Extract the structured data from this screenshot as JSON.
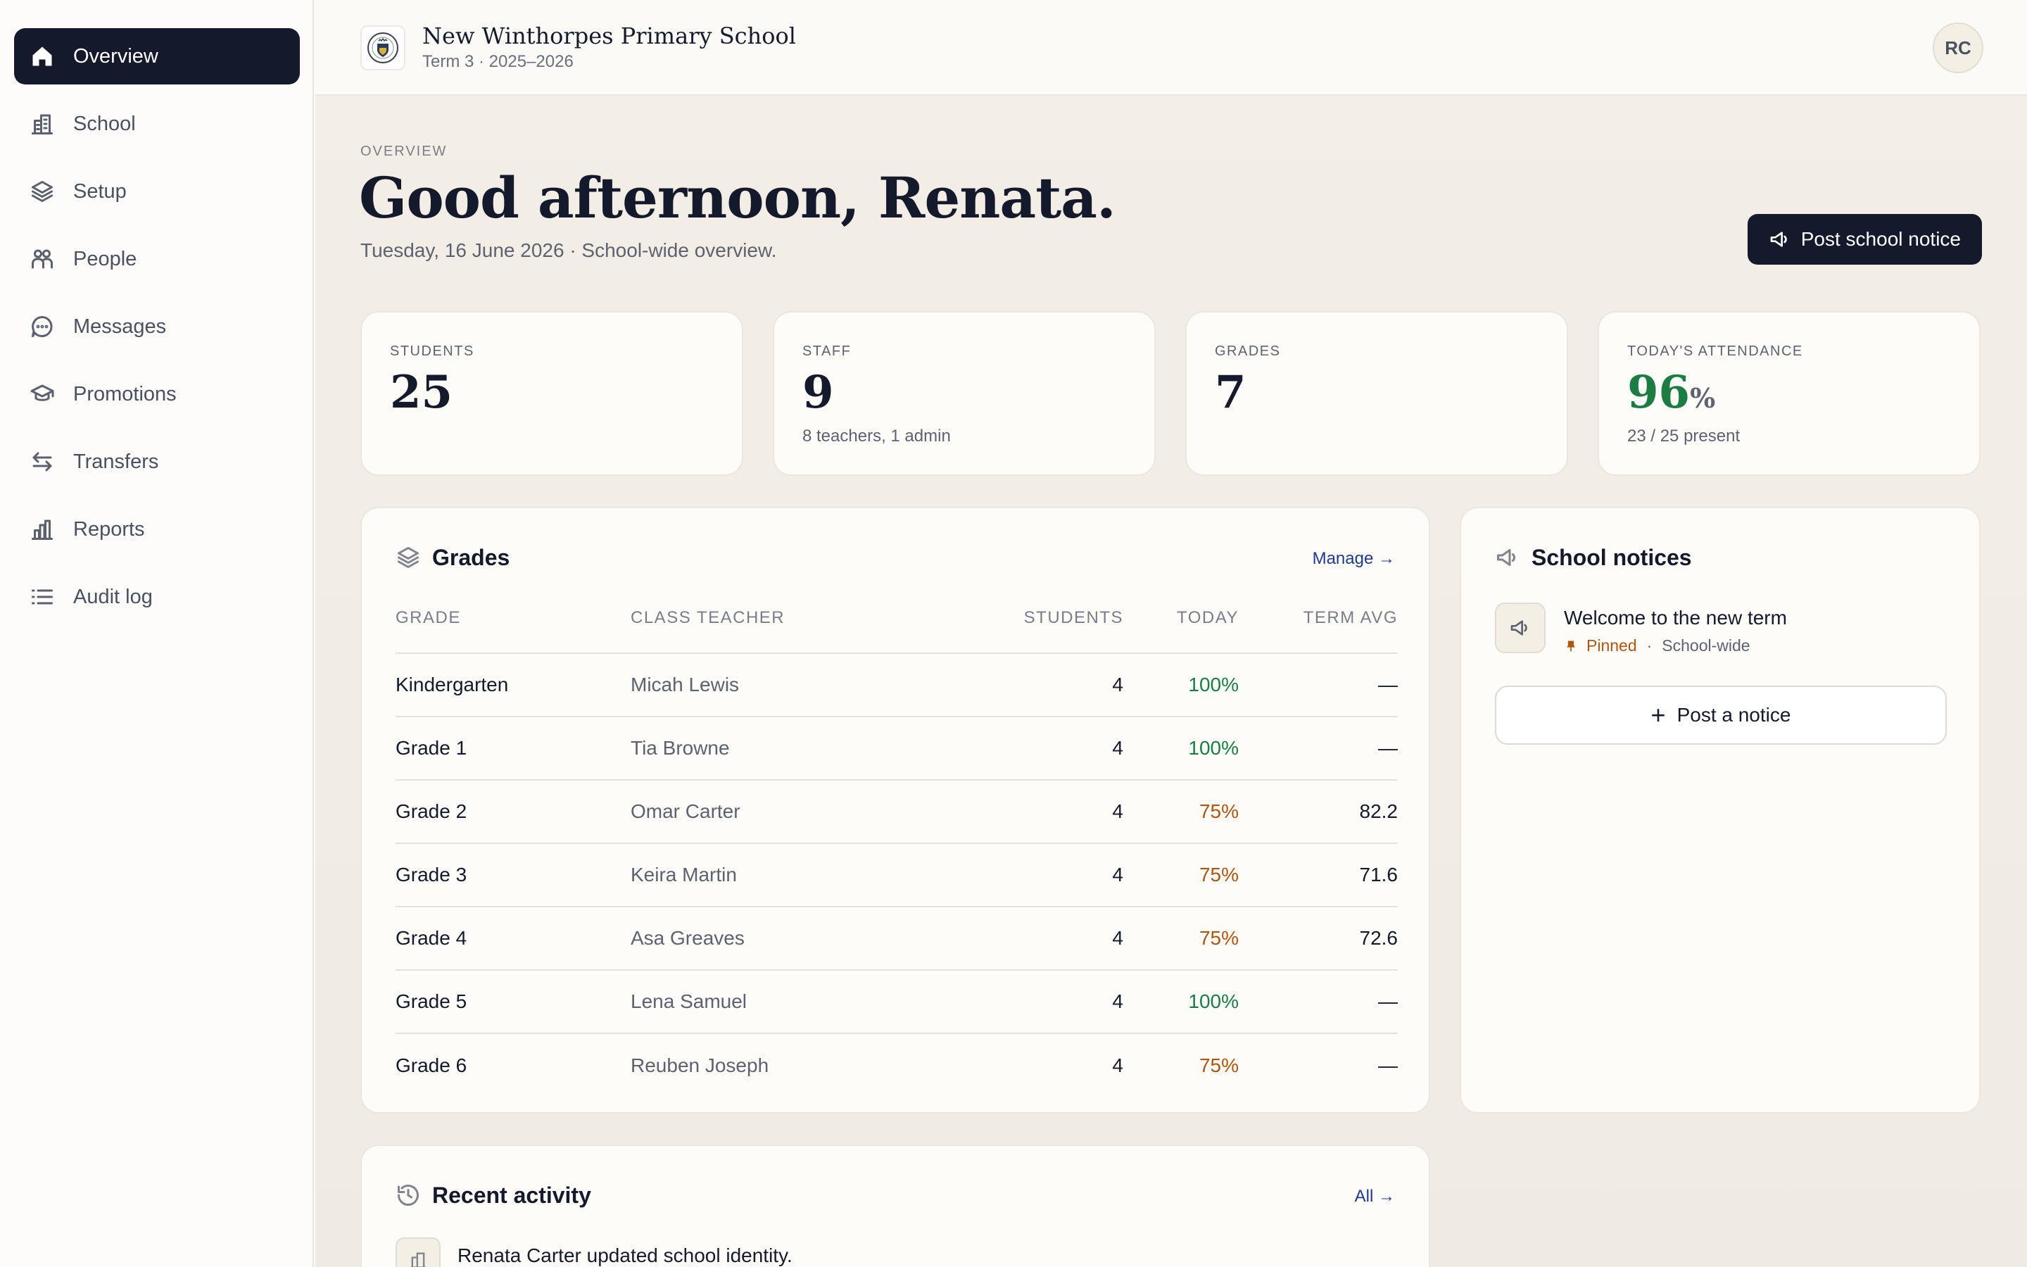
{
  "sidebar": {
    "items": [
      {
        "label": "Overview",
        "icon": "home-icon",
        "active": true
      },
      {
        "label": "School",
        "icon": "building-icon"
      },
      {
        "label": "Setup",
        "icon": "layers-icon"
      },
      {
        "label": "People",
        "icon": "people-icon"
      },
      {
        "label": "Messages",
        "icon": "message-icon"
      },
      {
        "label": "Promotions",
        "icon": "graduation-cap-icon"
      },
      {
        "label": "Transfers",
        "icon": "transfer-arrows-icon"
      },
      {
        "label": "Reports",
        "icon": "bar-chart-icon"
      },
      {
        "label": "Audit log",
        "icon": "list-icon"
      }
    ]
  },
  "header": {
    "school_name": "New Winthorpes Primary School",
    "term": "Term 3 · 2025–2026",
    "avatar_initials": "RC"
  },
  "page": {
    "eyebrow": "OVERVIEW",
    "greeting": "Good afternoon, Renata.",
    "date_line": "Tuesday, 16 June 2026 · School-wide overview.",
    "post_button": "Post school notice"
  },
  "stats": [
    {
      "label": "STUDENTS",
      "value": "25",
      "sub": ""
    },
    {
      "label": "STAFF",
      "value": "9",
      "sub": "8 teachers, 1 admin"
    },
    {
      "label": "GRADES",
      "value": "7",
      "sub": ""
    },
    {
      "label": "TODAY'S ATTENDANCE",
      "value": "96",
      "unit": "%",
      "sub": "23 / 25 present"
    }
  ],
  "grades_card": {
    "title": "Grades",
    "link": "Manage →",
    "columns": [
      "GRADE",
      "CLASS TEACHER",
      "STUDENTS",
      "TODAY",
      "TERM AVG"
    ],
    "rows": [
      {
        "grade": "Kindergarten",
        "teacher": "Micah Lewis",
        "students": "4",
        "today": "100%",
        "avg": "—",
        "status": "good"
      },
      {
        "grade": "Grade 1",
        "teacher": "Tia Browne",
        "students": "4",
        "today": "100%",
        "avg": "—",
        "status": "good"
      },
      {
        "grade": "Grade 2",
        "teacher": "Omar Carter",
        "students": "4",
        "today": "75%",
        "avg": "82.2",
        "status": "warn"
      },
      {
        "grade": "Grade 3",
        "teacher": "Keira Martin",
        "students": "4",
        "today": "75%",
        "avg": "71.6",
        "status": "warn"
      },
      {
        "grade": "Grade 4",
        "teacher": "Asa Greaves",
        "students": "4",
        "today": "75%",
        "avg": "72.6",
        "status": "warn"
      },
      {
        "grade": "Grade 5",
        "teacher": "Lena Samuel",
        "students": "4",
        "today": "100%",
        "avg": "—",
        "status": "good"
      },
      {
        "grade": "Grade 6",
        "teacher": "Reuben Joseph",
        "students": "4",
        "today": "75%",
        "avg": "—",
        "status": "warn"
      }
    ]
  },
  "notices_card": {
    "title": "School notices",
    "notice_title": "Welcome to the new term",
    "pinned_label": "Pinned",
    "separator": "·",
    "scope": "School-wide",
    "post_label": "Post a notice"
  },
  "activity_card": {
    "title": "Recent activity",
    "link": "All →",
    "entry_actor": "Renata Carter",
    "entry_action": " updated school identity."
  },
  "colors": {
    "accent_dark": "#141a2b",
    "good": "#1c7c43",
    "warn": "#b0550e",
    "link": "#1f3a8a"
  }
}
